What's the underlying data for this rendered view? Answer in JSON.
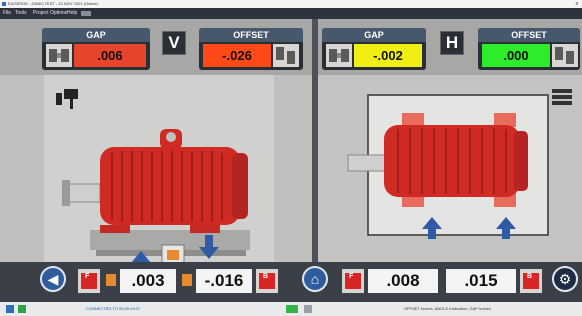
{
  "window": {
    "title": "EDGEROK - DEMO TEST - 23 NOV 2021 (Online)",
    "close": "x"
  },
  "menu": {
    "items": [
      "File",
      "Tools",
      "Project Options",
      "Help"
    ]
  },
  "vertical": {
    "gap": {
      "title": "GAP",
      "value": ".006",
      "color": "#e7442c"
    },
    "letter": "V",
    "offset": {
      "title": "OFFSET",
      "value": "-.026",
      "color": "#ff4a17"
    }
  },
  "horizontal": {
    "gap": {
      "title": "GAP",
      "value": "-.002",
      "color": "#f1ef12"
    },
    "letter": "H",
    "offset": {
      "title": "OFFSET",
      "value": ".000",
      "color": "#2ded2a"
    }
  },
  "bottom": {
    "left": {
      "foot_f": "F",
      "value_front": ".003",
      "value_back": "-.016",
      "foot_b": "B"
    },
    "right": {
      "foot_f": "F",
      "value_front": ".008",
      "value_back": ".015",
      "foot_b": "B"
    }
  },
  "taskbar": {
    "status": "CONNECTED TO 08:39:19:07",
    "right": "OFFSET Inches, ANGLE Inclination, GAP Inches"
  },
  "icons": [
    "back-arrow-icon",
    "home-icon",
    "settings-icon",
    "motor-icon",
    "shim-arrow-icon"
  ],
  "accent_colors": {
    "motor_red": "#d02a24",
    "arrow_blue": "#2f5aa4",
    "pane_bg": "#b7b7b5"
  }
}
